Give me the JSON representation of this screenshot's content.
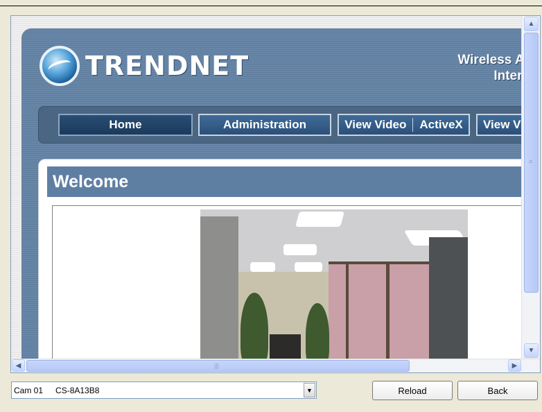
{
  "site": {
    "brand": "TRENDnet",
    "brand_display": "TRENDNET",
    "product_line1": "Wireless Advan",
    "product_line2": "Internet C"
  },
  "nav": {
    "items": [
      {
        "label": "Home",
        "active": true
      },
      {
        "label": "Administration",
        "active": false
      },
      {
        "label": "View Video",
        "sub": "ActiveX",
        "active": false
      },
      {
        "label": "View Vi",
        "active": false
      }
    ]
  },
  "content": {
    "title": "Welcome"
  },
  "bottom": {
    "camera_id": "Cam 01",
    "camera_name": "CS-8A13B8",
    "reload_label": "Reload",
    "back_label": "Back"
  },
  "icons": {
    "scroll_up": "arrow-up-icon",
    "scroll_down": "arrow-down-icon",
    "scroll_left": "arrow-left-icon",
    "scroll_right": "arrow-right-icon",
    "dropdown": "chevron-down-icon"
  },
  "colors": {
    "header_blue": "#5f7c9c",
    "welcome_bar": "#5f7fa2",
    "nav_button": "#2b5079"
  }
}
